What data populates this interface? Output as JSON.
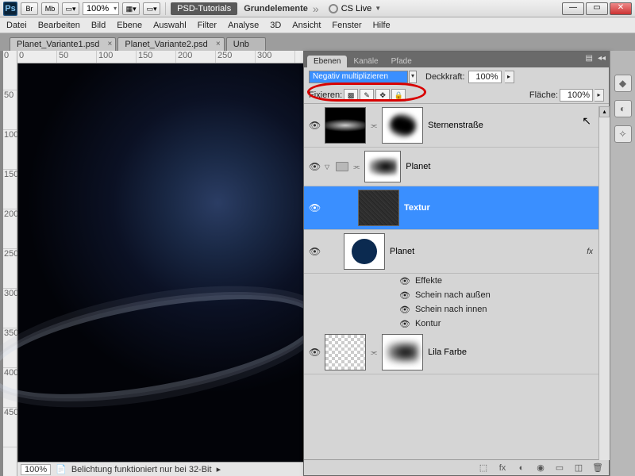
{
  "titlebar": {
    "zoom": "100%",
    "workspace_pill": "PSD-Tutorials",
    "workspace_label": "Grundelemente",
    "cslive": "CS Live"
  },
  "winbtn": {
    "min": "—",
    "max": "▭",
    "close": "✕"
  },
  "menu": {
    "datei": "Datei",
    "bearbeiten": "Bearbeiten",
    "bild": "Bild",
    "ebene": "Ebene",
    "auswahl": "Auswahl",
    "filter": "Filter",
    "analyse": "Analyse",
    "dreid": "3D",
    "ansicht": "Ansicht",
    "fenster": "Fenster",
    "hilfe": "Hilfe"
  },
  "tabs": {
    "t1": "Planet_Variante1.psd",
    "t2": "Planet_Variante2.psd",
    "t3": "Unb"
  },
  "hruler": [
    "0",
    "50",
    "100",
    "150",
    "200",
    "250",
    "300"
  ],
  "vruler": [
    "0",
    "50",
    "100",
    "150",
    "200",
    "250",
    "300",
    "350",
    "400",
    "450"
  ],
  "status": {
    "zoom": "100%",
    "msg": "Belichtung funktioniert nur bei 32-Bit"
  },
  "panel": {
    "tabs": {
      "ebenen": "Ebenen",
      "kanaele": "Kanäle",
      "pfade": "Pfade"
    },
    "blend_mode": "Negativ multiplizieren",
    "deckkraft_label": "Deckkraft:",
    "deckkraft_value": "100%",
    "fixieren_label": "Fixieren:",
    "flaeche_label": "Fläche:",
    "flaeche_value": "100%"
  },
  "layers": {
    "sternenstrasse": "Sternenstraße",
    "planet_group": "Planet",
    "textur": "Textur",
    "planet_shape": "Planet",
    "effekte": "Effekte",
    "schein_aussen": "Schein nach außen",
    "schein_innen": "Schein nach innen",
    "kontur": "Kontur",
    "lila": "Lila Farbe",
    "fx": "fx"
  },
  "footer_icons": [
    "⬚",
    "fx",
    "◐",
    "◉",
    "▭",
    "◫",
    "🗑"
  ]
}
